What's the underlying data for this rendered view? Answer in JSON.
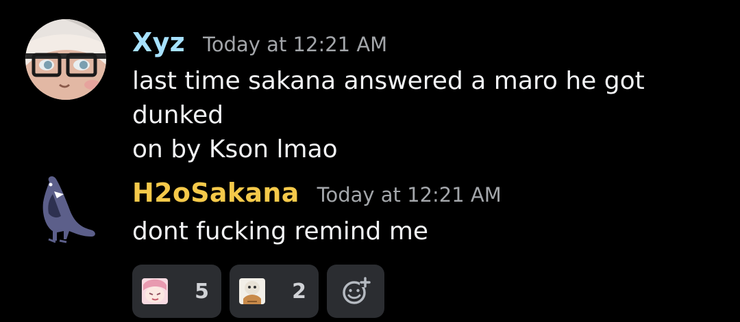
{
  "colors": {
    "background": "#000000",
    "username_1": "#a6e1ff",
    "username_2": "#f5c94a",
    "timestamp": "#a3a6aa",
    "text": "#f2f3f5",
    "reaction_bg": "#2b2d31"
  },
  "messages": [
    {
      "username": "Xyz",
      "timestamp": "Today at 12:21 AM",
      "text": "last time sakana answered a maro he got dunked\non by Kson lmao",
      "avatar_icon": "glasses-face-avatar"
    },
    {
      "username": "H2oSakana",
      "timestamp": "Today at 12:21 AM",
      "text": "dont fucking remind me",
      "avatar_icon": "fish-in-suit-avatar",
      "reactions": [
        {
          "emoji": "pink-haired-girl-emoji",
          "count": "5"
        },
        {
          "emoji": "pepe-frog-emoji",
          "count": "2"
        }
      ],
      "add_reaction_icon": "add-reaction-icon"
    }
  ]
}
